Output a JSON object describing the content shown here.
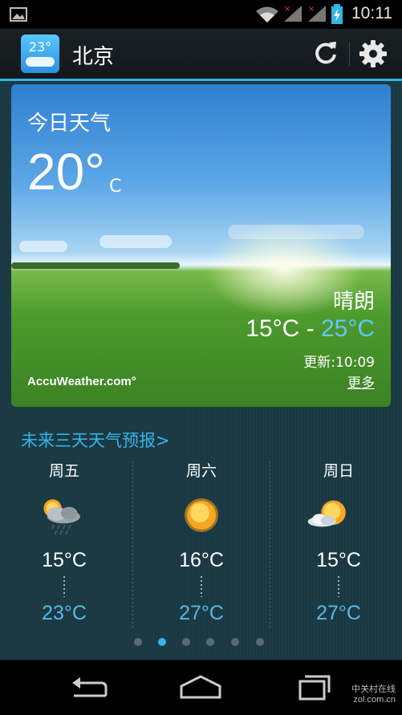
{
  "status_bar": {
    "time": "10:11",
    "icons": [
      "image-notification-icon",
      "wifi-icon",
      "signal-icon",
      "signal-icon",
      "battery-charging-icon"
    ]
  },
  "app_bar": {
    "icon_text": "23°",
    "city": "北京",
    "refresh_icon": "refresh-icon",
    "settings_icon": "gear-icon"
  },
  "current": {
    "title": "今日天气",
    "temp": "20°",
    "unit": "C",
    "condition": "晴朗",
    "low": "15°C",
    "separator": " - ",
    "high": "25°C",
    "updated": "更新:10:09",
    "more": "更多",
    "provider": "AccuWeather.com°"
  },
  "forecast": {
    "heading": "未来三天天气预报>",
    "days": [
      {
        "day": "周五",
        "icon": "sun-cloud-rain-icon",
        "low": "15°C",
        "high": "23°C"
      },
      {
        "day": "周六",
        "icon": "sunny-icon",
        "low": "16°C",
        "high": "27°C"
      },
      {
        "day": "周日",
        "icon": "sun-cloud-icon",
        "low": "15°C",
        "high": "27°C"
      }
    ]
  },
  "pager": {
    "count": 6,
    "active_index": 1
  },
  "watermark": {
    "line1": "中关村在线",
    "line2": "zol.com.cn"
  },
  "colors": {
    "accent": "#33b5e5",
    "high_temp": "#56b9e8"
  }
}
